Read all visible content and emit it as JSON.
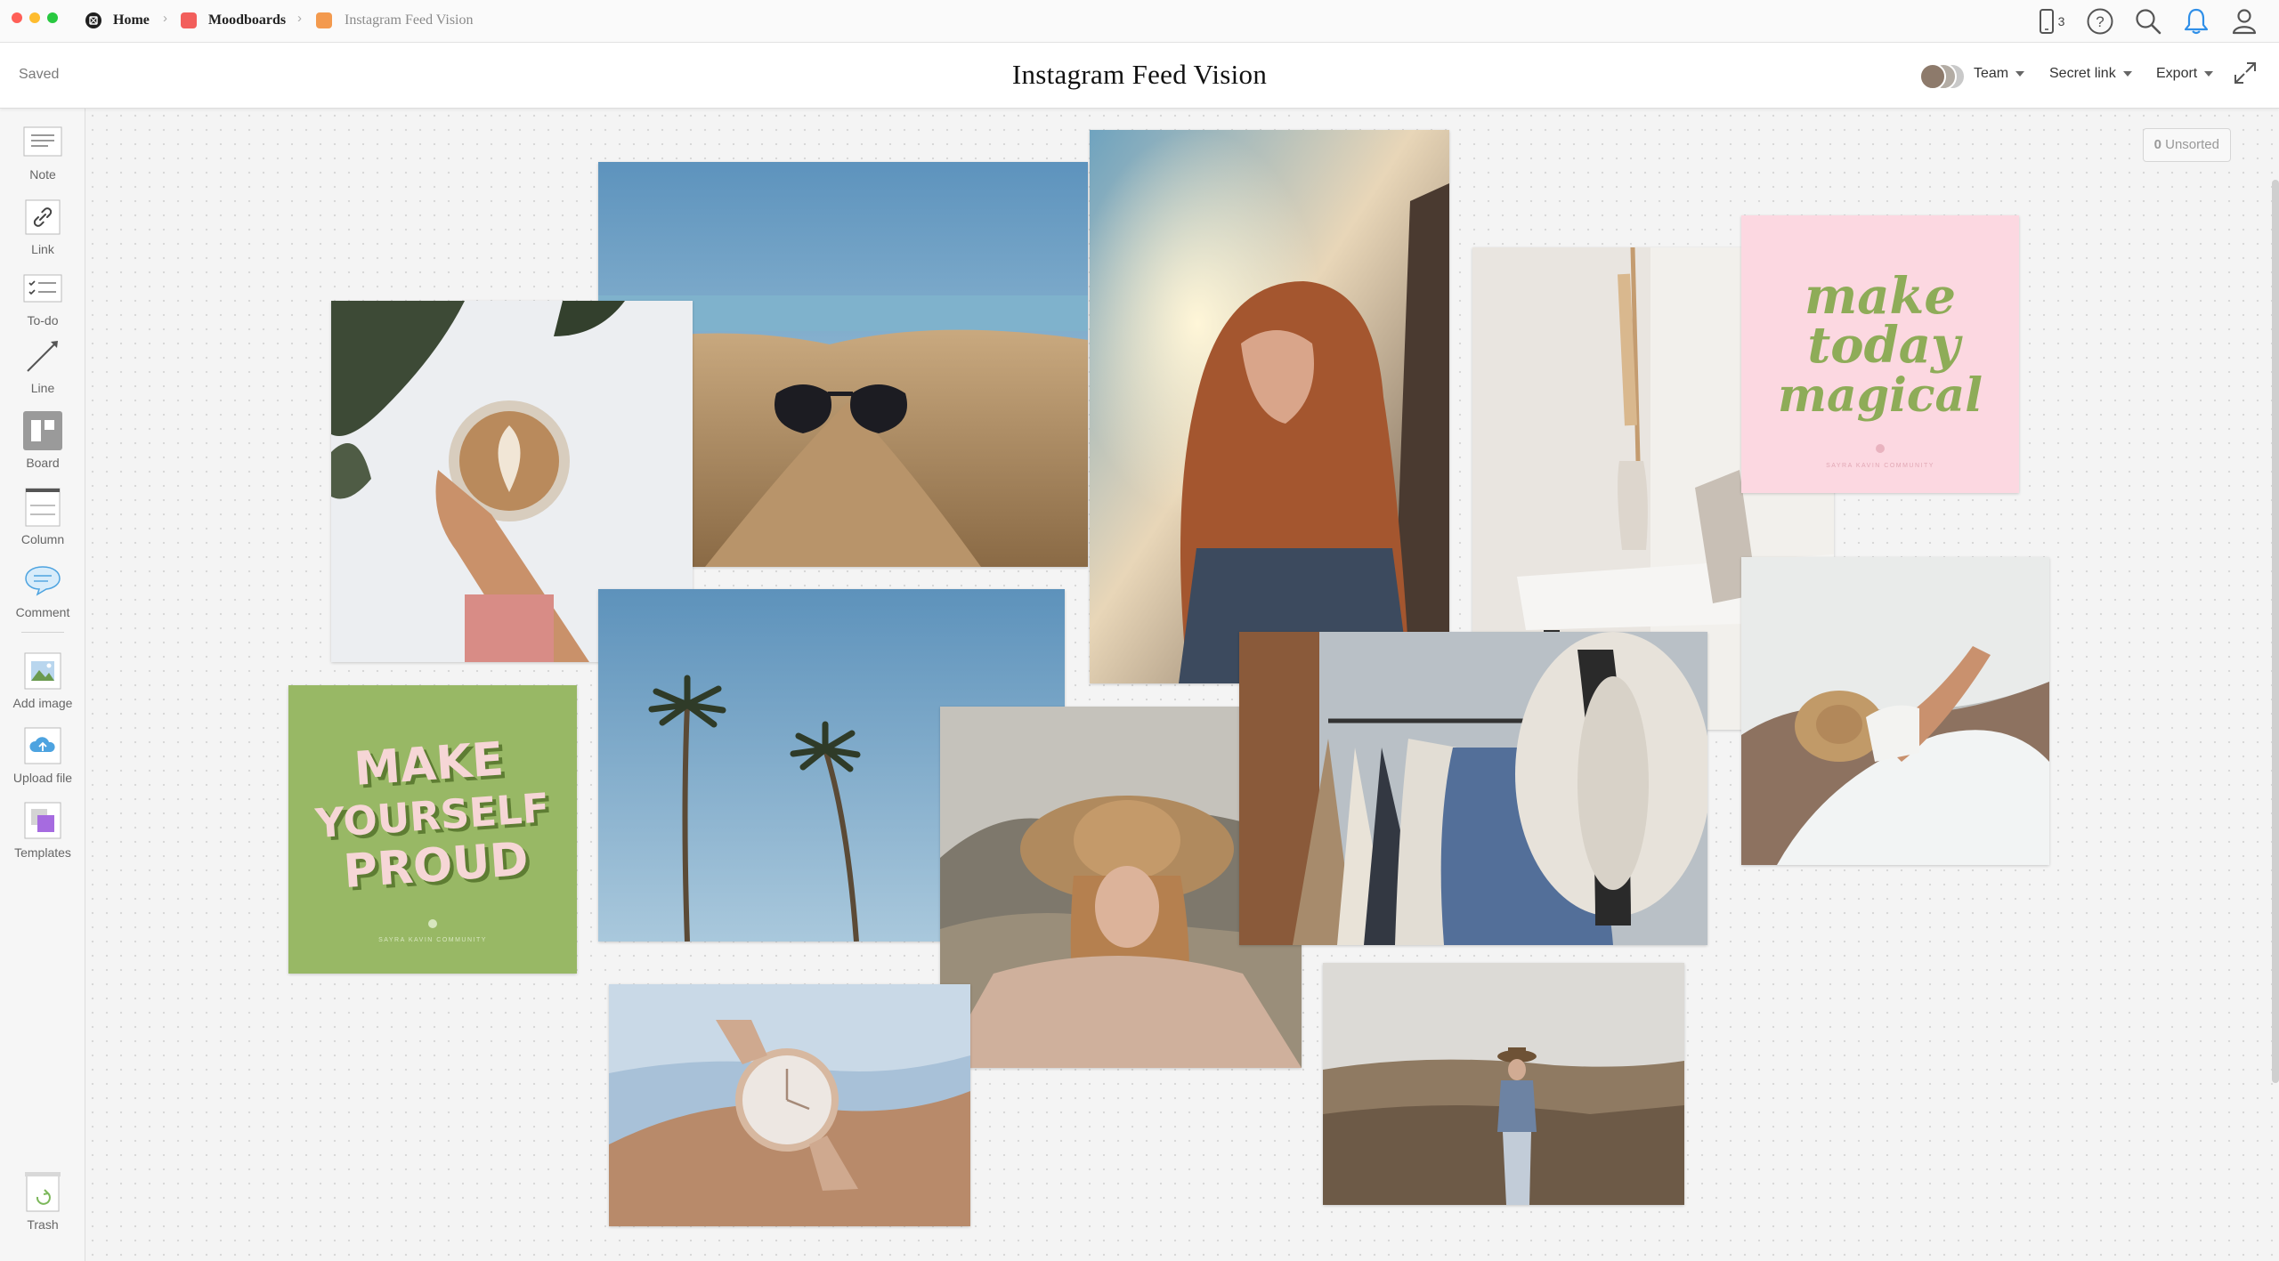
{
  "window": {
    "breadcrumb": [
      {
        "label": "Home",
        "icon": "milanote-logo-icon"
      },
      {
        "label": "Moodboards",
        "icon": "moodboard-board-icon",
        "color": "#f25f5c"
      },
      {
        "label": "Instagram Feed Vision",
        "icon": "board-icon",
        "color": "#f39a4e"
      }
    ],
    "device_count": "3",
    "traffic_colors": [
      "#ff5f57",
      "#febc2e",
      "#28c840"
    ]
  },
  "header": {
    "status": "Saved",
    "title": "Instagram Feed Vision",
    "menus": {
      "team": "Team",
      "secret_link": "Secret link",
      "export": "Export"
    }
  },
  "toolbar": {
    "tools": [
      {
        "label": "Note",
        "icon": "note-icon"
      },
      {
        "label": "Link",
        "icon": "link-icon"
      },
      {
        "label": "To-do",
        "icon": "todo-icon"
      },
      {
        "label": "Line",
        "icon": "line-icon"
      },
      {
        "label": "Board",
        "icon": "board-tool-icon"
      },
      {
        "label": "Column",
        "icon": "column-icon"
      },
      {
        "label": "Comment",
        "icon": "comment-icon"
      },
      {
        "label": "Add image",
        "icon": "add-image-icon"
      },
      {
        "label": "Upload file",
        "icon": "upload-cloud-icon"
      },
      {
        "label": "Templates",
        "icon": "templates-icon"
      }
    ],
    "trash": {
      "label": "Trash",
      "icon": "trash-icon"
    }
  },
  "canvas": {
    "unsorted_count": "0",
    "unsorted_label": "Unsorted",
    "quote_cards": [
      {
        "text": "MAKE YOURSELF PROUD",
        "lines": [
          "MAKE",
          "YOURSELF",
          "PROUD"
        ],
        "background": "#98b865",
        "ink": "#f6d6d6",
        "credit": "SAYRA KAVIN COMMUNITY"
      },
      {
        "text": "make today magical",
        "lines": [
          "make",
          "today",
          "magical"
        ],
        "background": "#fcd8e1",
        "ink": "#8eac58",
        "credit": "SAYRA KAVIN COMMUNITY"
      }
    ],
    "photos": [
      "sunglasses-on-beach-photo",
      "woman-with-long-hair-photo",
      "latte-art-cup-photo",
      "pampas-grass-shelf-photo",
      "palm-trees-sky-photo",
      "woman-in-straw-hat-photo",
      "clothes-rack-hat-photo",
      "woman-on-beach-photo",
      "wristwatch-photo",
      "woman-in-field-photo"
    ]
  }
}
